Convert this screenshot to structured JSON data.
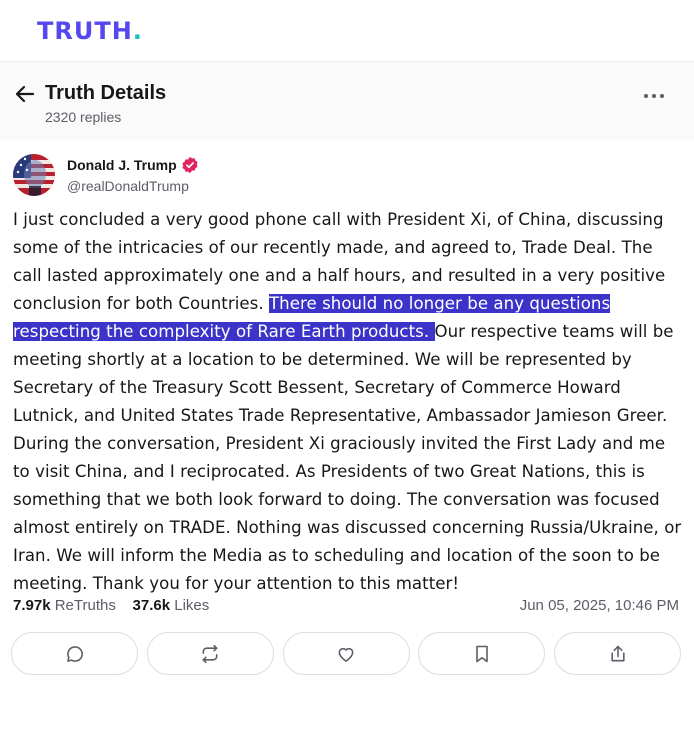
{
  "brand": {
    "logo_text": "TRUTH",
    "logo_dot": ".",
    "logo_color": "#5448ee",
    "dot_color": "#17c8b5"
  },
  "header": {
    "title": "Truth Details",
    "replies": "2320 replies",
    "back_icon": "arrow-left-icon",
    "more_icon": "more-horizontal-icon"
  },
  "post": {
    "author": "Donald J. Trump",
    "handle": "@realDonaldTrump",
    "verified_icon": "verified-badge-icon",
    "text_before": "I just concluded a very good phone call with President Xi, of China, discussing some of the intricacies of our recently made, and agreed to, Trade Deal. The call lasted approximately one and a half hours, and resulted in a very positive conclusion for both Countries. ",
    "text_highlight": "There should no longer be any questions respecting the complexity of Rare Earth products. ",
    "text_after": "Our respective teams will be meeting shortly at a location to be determined. We will be represented by Secretary of the Treasury Scott Bessent, Secretary of Commerce Howard Lutnick, and United States Trade Representative, Ambassador Jamieson Greer. During the conversation, President Xi graciously invited the First Lady and me to visit China, and I reciprocated. As Presidents of two Great Nations, this is something that we both look forward to doing. The conversation was focused almost entirely on TRADE. Nothing was discussed concerning Russia/Ukraine, or Iran. We will inform the Media as to scheduling and location of the soon to be meeting. Thank you for your attention to this matter!",
    "highlight_color": "#3c34c9",
    "retruths_count": "7.97k",
    "retruths_label": "ReTruths",
    "likes_count": "37.6k",
    "likes_label": "Likes",
    "timestamp": "Jun 05, 2025, 10:46 PM"
  },
  "actions": [
    {
      "icon": "reply-icon"
    },
    {
      "icon": "retruth-icon"
    },
    {
      "icon": "like-icon"
    },
    {
      "icon": "bookmark-icon"
    },
    {
      "icon": "share-icon"
    }
  ]
}
